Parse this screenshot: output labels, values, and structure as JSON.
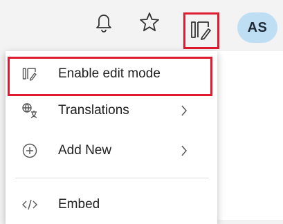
{
  "header": {
    "notifications": {
      "icon": "bell-icon"
    },
    "favorite": {
      "icon": "star-icon"
    },
    "edit_mode_toggle": {
      "icon": "edit-mode-icon"
    },
    "avatar": {
      "initials": "AS",
      "color": "#bedff3"
    }
  },
  "menu": {
    "items": [
      {
        "label": "Enable edit mode",
        "icon": "edit-mode-icon",
        "has_submenu": false
      },
      {
        "label": "Translations",
        "icon": "translate-icon",
        "has_submenu": true
      },
      {
        "label": "Add New",
        "icon": "add-circle-icon",
        "has_submenu": true
      },
      {
        "label": "Embed",
        "icon": "code-icon",
        "has_submenu": false
      }
    ]
  },
  "colors": {
    "highlight": "#e01b2f",
    "avatar_bg": "#bedff3",
    "topbar_bg": "#f3f3f3"
  }
}
